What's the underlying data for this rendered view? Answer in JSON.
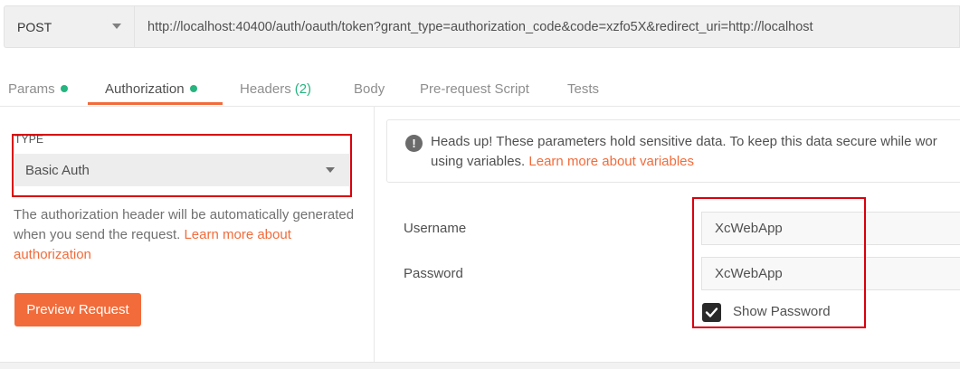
{
  "request": {
    "method": "POST",
    "url": "http://localhost:40400/auth/oauth/token?grant_type=authorization_code&code=xzfo5X&redirect_uri=http://localhost"
  },
  "tabs": [
    {
      "label": "Params",
      "indicator": "dot"
    },
    {
      "label": "Authorization",
      "indicator": "dot",
      "active": true
    },
    {
      "label": "Headers",
      "count": "(2)"
    },
    {
      "label": "Body"
    },
    {
      "label": "Pre-request Script"
    },
    {
      "label": "Tests"
    }
  ],
  "auth": {
    "type_label": "TYPE",
    "type_value": "Basic Auth",
    "description": "The authorization header will be automatically generated when you send the request. ",
    "description_link": "Learn more about authorization",
    "preview_button": "Preview Request"
  },
  "notice": {
    "text": "Heads up! These parameters hold sensitive data. To keep this data secure while wor",
    "text_line2": "using variables. ",
    "link": "Learn more about variables"
  },
  "fields": {
    "username_label": "Username",
    "username_value": "XcWebApp",
    "password_label": "Password",
    "password_value": "XcWebApp",
    "show_password_label": "Show Password",
    "show_password_checked": true
  },
  "colors": {
    "accent": "#f26b3a",
    "status_dot": "#26b47f",
    "highlight_box": "#d9000d"
  }
}
